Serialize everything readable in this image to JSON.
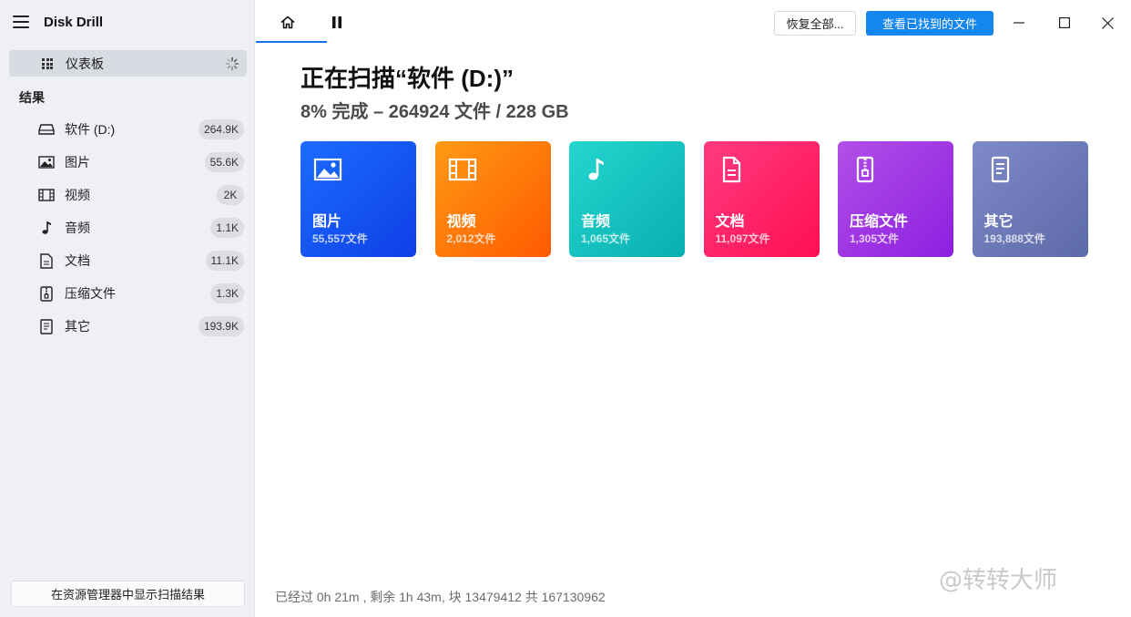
{
  "app": {
    "title": "Disk Drill"
  },
  "sidebar": {
    "dashboard_label": "仪表板",
    "section_title": "结果",
    "items": [
      {
        "label": "软件 (D:)",
        "count": "264.9K",
        "icon": "drive-icon"
      },
      {
        "label": "图片",
        "count": "55.6K",
        "icon": "image-icon"
      },
      {
        "label": "视频",
        "count": "2K",
        "icon": "film-icon"
      },
      {
        "label": "音频",
        "count": "1.1K",
        "icon": "music-note-icon"
      },
      {
        "label": "文档",
        "count": "11.1K",
        "icon": "document-icon"
      },
      {
        "label": "压缩文件",
        "count": "1.3K",
        "icon": "archive-icon"
      },
      {
        "label": "其它",
        "count": "193.9K",
        "icon": "other-file-icon"
      }
    ],
    "bottom_button": "在资源管理器中显示扫描结果"
  },
  "toolbar": {
    "restore_all_label": "恢复全部...",
    "view_found_label": "查看已找到的文件"
  },
  "main": {
    "title": "正在扫描“软件 (D:)”",
    "subtitle": "8% 完成 – 264924 文件 / 228 GB",
    "progress_percent": 8,
    "cards": [
      {
        "name": "图片",
        "count": "55,557文件",
        "icon": "image-icon",
        "color_top": "#1c6cff",
        "color_bottom": "#0f3fe6"
      },
      {
        "name": "视频",
        "count": "2,012文件",
        "icon": "film-icon",
        "color_top": "#ff9a14",
        "color_bottom": "#ff5a00"
      },
      {
        "name": "音频",
        "count": "1,065文件",
        "icon": "music-note-icon",
        "color_top": "#25d6cf",
        "color_bottom": "#08aeb0"
      },
      {
        "name": "文档",
        "count": "11,097文件",
        "icon": "document-icon",
        "color_top": "#ff3a80",
        "color_bottom": "#ff0f52"
      },
      {
        "name": "压缩文件",
        "count": "1,305文件",
        "icon": "archive-icon",
        "color_top": "#b34fe8",
        "color_bottom": "#8c1fe0"
      },
      {
        "name": "其它",
        "count": "193,888文件",
        "icon": "other-file-icon",
        "color_top": "#7f8bc9",
        "color_bottom": "#5d6aa8"
      }
    ],
    "status_line": "已经过 0h 21m , 剩余 1h 43m, 块 13479412 共 167130962"
  },
  "watermark": "@转转大师",
  "colors": {
    "accent": "#1486f0",
    "sidebar_bg": "#eef0f5"
  }
}
